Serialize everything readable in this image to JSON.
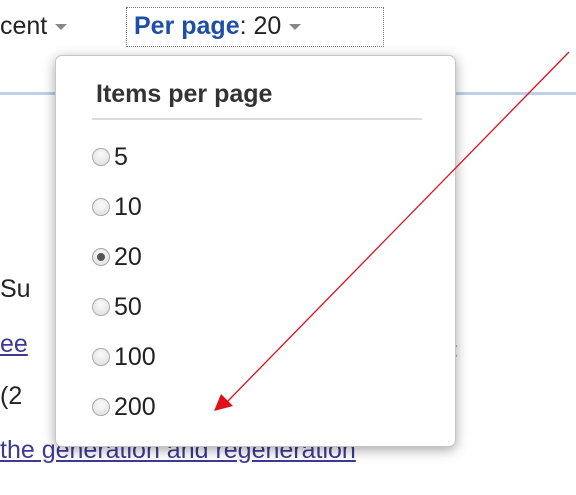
{
  "toolbar": {
    "sort_fragment": "cent",
    "per_page_label": "Per page",
    "per_page_value": ": 20"
  },
  "background": {
    "fragment_su": "Su",
    "link_ee": "ee",
    "fragment_colon": ":",
    "fragment_2": "(2",
    "link_generation": " the generation and regeneration"
  },
  "popup": {
    "title": "Items per page",
    "options": [
      {
        "label": "5",
        "checked": false
      },
      {
        "label": "10",
        "checked": false
      },
      {
        "label": "20",
        "checked": true
      },
      {
        "label": "50",
        "checked": false
      },
      {
        "label": "100",
        "checked": false
      },
      {
        "label": "200",
        "checked": false
      }
    ]
  },
  "annotation": {
    "arrow_color": "#e0101a"
  }
}
